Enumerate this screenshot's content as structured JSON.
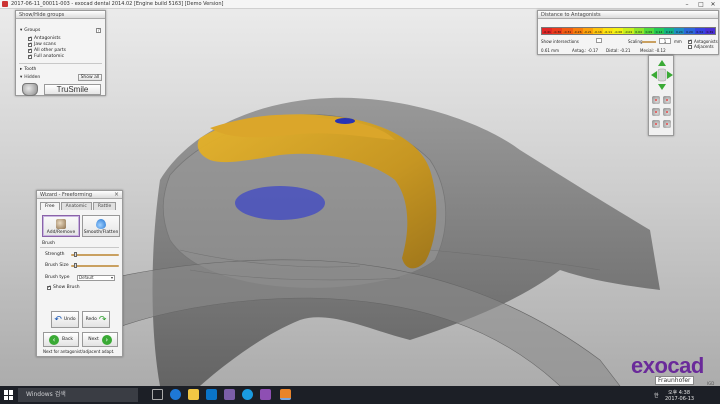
{
  "window": {
    "title": "2017-06-11_00011-003 - exocad dental 2014.02 [Engine build 5163] [Demo Version]",
    "minimize": "–",
    "maximize": "□",
    "close": "✕"
  },
  "groups_panel": {
    "title": "Show/Hide groups",
    "groups_label": "Groups",
    "help": "?",
    "items": [
      {
        "label": "Antagonists",
        "checked": true
      },
      {
        "label": "Jaw scans",
        "checked": true
      },
      {
        "label": "All other parts",
        "checked": true
      },
      {
        "label": "Full anatomic",
        "checked": true
      }
    ],
    "tooth_label": "Tooth",
    "hidden_label": "Hidden",
    "show_all_label": "Show all",
    "trusmile_label": "TruSmile"
  },
  "distance_panel": {
    "title": "Distance to Antagonists",
    "scale_values": [
      "-0.41",
      "-0.36",
      "-0.31",
      "-0.26",
      "-0.21",
      "-0.16",
      "-0.11",
      "-0.06",
      "-0.01",
      "0.04",
      "0.09",
      "0.14",
      "0.19",
      "0.24",
      "0.29",
      "0.34",
      "0.39"
    ],
    "scale_colors": [
      "#e22626",
      "#ec3a1c",
      "#f25a12",
      "#f77d0c",
      "#fba00a",
      "#fdc40c",
      "#fde30f",
      "#f2f214",
      "#c8f01c",
      "#8ee62a",
      "#4fda3c",
      "#23c955",
      "#13b184",
      "#1e8fc0",
      "#2b67d8",
      "#3544df",
      "#4a2fd5"
    ],
    "antagonists_label": "Antagonists",
    "adjacents_label": "Adjacents",
    "show_intersections_label": "Show intersections",
    "scaling_label": "Scaling",
    "scaling_value": "1",
    "unit": "mm",
    "distance_value": "0.61 mm",
    "antag_label": "Antag.: -0.17",
    "distal_label": "Distal: -0.21",
    "mesial_label": "Mesial: -0.12"
  },
  "wizard_panel": {
    "title": "Wizard - Freeforming",
    "tabs": [
      "Free",
      "Anatomic",
      "Rattle"
    ],
    "add_remove_label": "Add/Remove",
    "smooth_label": "Smooth/Flatten",
    "brush_label": "Brush",
    "strength_label": "Strength",
    "strength_value": 0.06,
    "brush_size_label": "Brush Size",
    "brush_size_value": 0.06,
    "brush_type_label": "Brush type",
    "brush_type_value": "Default",
    "show_brush_label": "Show Brush",
    "undo_label": "Undo",
    "redo_label": "Redo",
    "back_label": "Back",
    "next_label": "Next",
    "status_text": "Next for antagonist/adjacent adapt."
  },
  "logo": {
    "name": "exocad",
    "partner": "Fraunhofer",
    "tag": "IGD"
  },
  "taskbar": {
    "search_placeholder": "Windows 검색",
    "lang": "한",
    "time": "오후 4:38",
    "date": "2017-06-13"
  }
}
